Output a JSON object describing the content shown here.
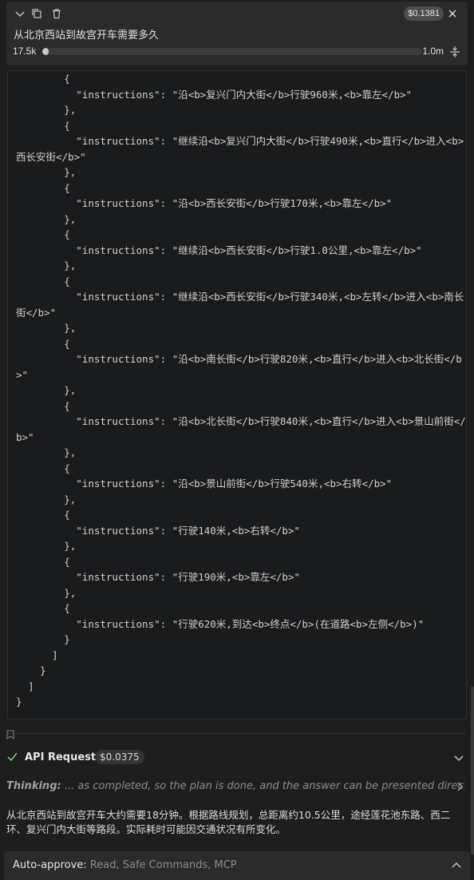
{
  "header": {
    "cost": "$0.1381",
    "title": "从北京西站到故宫开车需要多久",
    "context_left": "17.5k",
    "context_right": "1.0m",
    "context_fill_fraction": 0.017
  },
  "code_lines": [
    "        {",
    "          \"instructions\": \"沿<b>复兴门内大街</b>行驶960米,<b>靠左</b>\"",
    "        },",
    "        {",
    "          \"instructions\": \"继续沿<b>复兴门内大街</b>行驶490米,<b>直行</b>进入<b>西长安街</b>\"",
    "        },",
    "        {",
    "          \"instructions\": \"沿<b>西长安街</b>行驶170米,<b>靠左</b>\"",
    "        },",
    "        {",
    "          \"instructions\": \"继续沿<b>西长安街</b>行驶1.0公里,<b>靠左</b>\"",
    "        },",
    "        {",
    "          \"instructions\": \"继续沿<b>西长安街</b>行驶340米,<b>左转</b>进入<b>南长街</b>\"",
    "        },",
    "        {",
    "          \"instructions\": \"沿<b>南长街</b>行驶820米,<b>直行</b>进入<b>北长街</b>\"",
    "        },",
    "        {",
    "          \"instructions\": \"沿<b>北长街</b>行驶840米,<b>直行</b>进入<b>景山前街</b>\"",
    "        },",
    "        {",
    "          \"instructions\": \"沿<b>景山前街</b>行驶540米,<b>右转</b>\"",
    "        },",
    "        {",
    "          \"instructions\": \"行驶140米,<b>右转</b>\"",
    "        },",
    "        {",
    "          \"instructions\": \"行驶190米,<b>靠左</b>\"",
    "        },",
    "        {",
    "          \"instructions\": \"行驶620米,到达<b>终点</b>(在道路<b>左侧</b>)\"",
    "        }",
    "      ]",
    "    }",
    "  ]",
    "}"
  ],
  "api_request": {
    "label": "API Request",
    "cost": "$0.0375"
  },
  "thinking": {
    "label": "Thinking:",
    "text": " ... as completed, so the plan is done, and the answer can be presented directly."
  },
  "answer": "从北京西站到故宫开车大约需要18分钟。根据路线规划，总距离约10.5公里，途经莲花池东路、西二环、复兴门内大街等路段。实际耗时可能因交通状况有所变化。",
  "auto_approve": {
    "label": "Auto-approve:",
    "value": " Read, Safe Commands, MCP"
  },
  "icons": {
    "collapse": "chevron-down-icon",
    "copy": "copy-icon",
    "delete": "trash-icon",
    "close": "close-icon",
    "compress": "compress-icon",
    "check": "check-icon",
    "bookmark": "bookmark-icon"
  }
}
